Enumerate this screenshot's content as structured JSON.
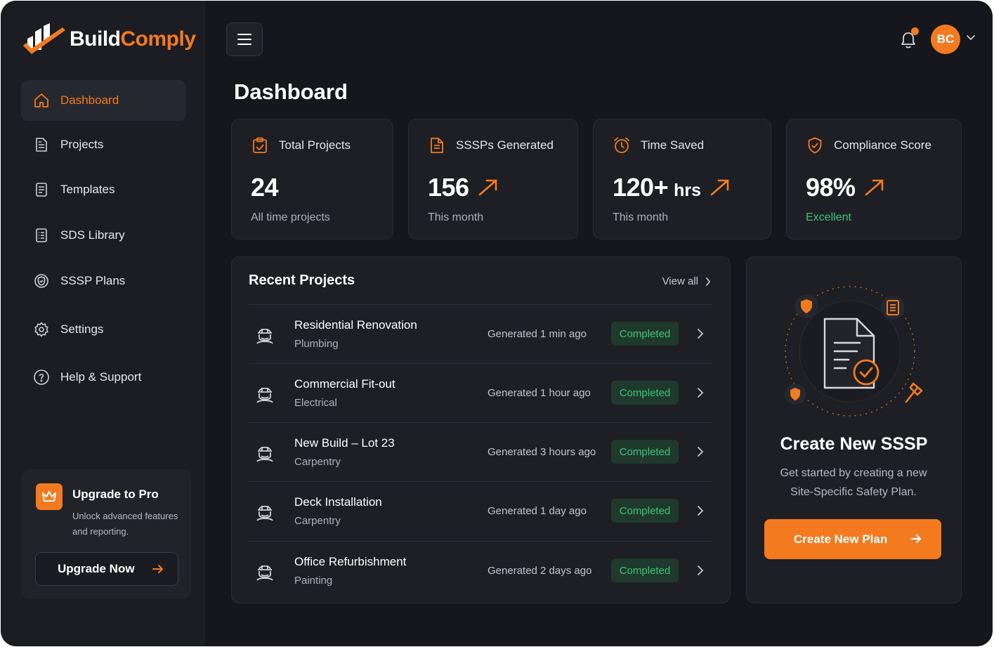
{
  "brand": {
    "name_part1": "Build",
    "name_part2": "Comply",
    "logo_icon": "building-check-logo",
    "accent": "#f47a1f"
  },
  "sidebar": {
    "items": [
      {
        "label": "Dashboard",
        "icon": "home-icon",
        "active": true
      },
      {
        "label": "Projects",
        "icon": "document-icon"
      },
      {
        "label": "Templates",
        "icon": "template-icon"
      },
      {
        "label": "SDS Library",
        "icon": "library-icon"
      },
      {
        "label": "SSSP Plans",
        "icon": "shield-plan-icon"
      },
      {
        "label": "Settings",
        "icon": "gear-icon"
      },
      {
        "label": "Help & Support",
        "icon": "help-icon"
      }
    ],
    "upgrade": {
      "title": "Upgrade to Pro",
      "subtitle": "Unlock advanced features and reporting.",
      "button": "Upgrade Now",
      "icon": "crown-icon"
    }
  },
  "header": {
    "menu_icon": "hamburger-icon",
    "notification_icon": "bell-icon",
    "avatar_initials": "BC"
  },
  "page_title": "Dashboard",
  "stats": [
    {
      "label": "Total Projects",
      "value": "24",
      "unit": "",
      "sub": "All time projects",
      "icon": "clipboard-check-icon",
      "trend": false
    },
    {
      "label": "SSSPs Generated",
      "value": "156",
      "unit": "",
      "sub": "This month",
      "icon": "document-lines-icon",
      "trend": true
    },
    {
      "label": "Time Saved",
      "value": "120+",
      "unit": "hrs",
      "sub": "This month",
      "icon": "alarm-clock-icon",
      "trend": true
    },
    {
      "label": "Compliance Score",
      "value": "98%",
      "unit": "",
      "sub": "Excellent",
      "icon": "shield-check-icon",
      "trend": true
    }
  ],
  "recent": {
    "title": "Recent Projects",
    "view_all": "View all",
    "projects": [
      {
        "name": "Residential Renovation",
        "category": "Plumbing",
        "generated": "Generated 1 min ago",
        "status": "Completed"
      },
      {
        "name": "Commercial Fit-out",
        "category": "Electrical",
        "generated": "Generated 1 hour ago",
        "status": "Completed"
      },
      {
        "name": "New Build – Lot 23",
        "category": "Carpentry",
        "generated": "Generated 3 hours ago",
        "status": "Completed"
      },
      {
        "name": "Deck Installation",
        "category": "Carpentry",
        "generated": "Generated 1 day ago",
        "status": "Completed"
      },
      {
        "name": "Office Refurbishment",
        "category": "Painting",
        "generated": "Generated 2 days ago",
        "status": "Completed"
      }
    ]
  },
  "cta": {
    "title": "Create New SSSP",
    "description": "Get started by creating a new Site-Specific Safety Plan.",
    "button": "Create New Plan"
  },
  "colors": {
    "background": "#15171c",
    "sidebar": "#1b1d22",
    "card": "#1d1f24",
    "success": "#3fc37a",
    "success_bg": "#1f3a2c"
  }
}
